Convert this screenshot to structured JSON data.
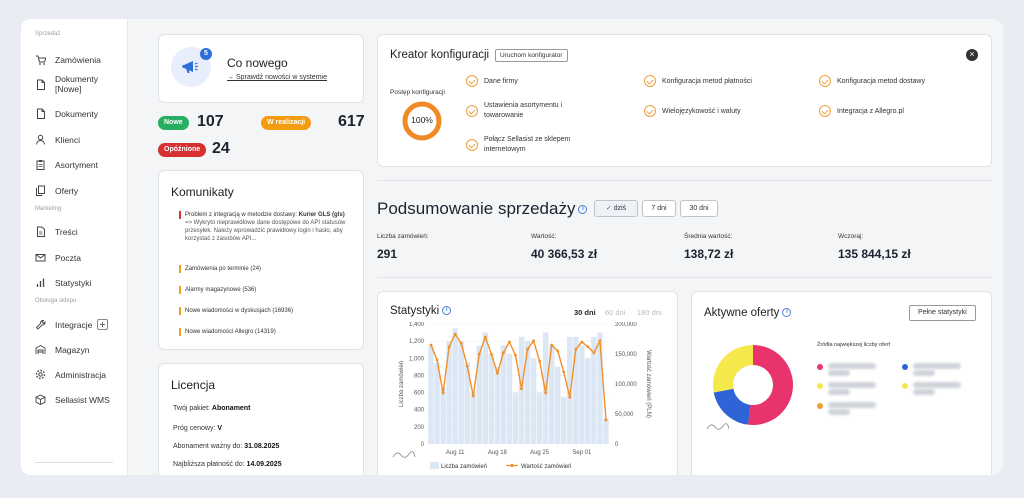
{
  "sidebar": {
    "sections": [
      {
        "title": "Sprzedaż",
        "items": [
          {
            "label": "Zamówienia",
            "icon": "cart-icon"
          },
          {
            "label": "Dokumenty\n[Nowe]",
            "icon": "document-icon"
          },
          {
            "label": "Dokumenty",
            "icon": "document-icon"
          },
          {
            "label": "Klienci",
            "icon": "user-icon"
          },
          {
            "label": "Asortyment",
            "icon": "clipboard-icon"
          },
          {
            "label": "Oferty",
            "icon": "copy-icon"
          }
        ]
      },
      {
        "title": "Marketing",
        "items": [
          {
            "label": "Treści",
            "icon": "file-text-icon"
          },
          {
            "label": "Poczta",
            "icon": "mail-icon"
          },
          {
            "label": "Statystyki",
            "icon": "bar-chart-icon"
          }
        ]
      },
      {
        "title": "Obsługa sklepu",
        "items": [
          {
            "label": "Integracje",
            "icon": "wrench-icon"
          },
          {
            "label": "Magazyn",
            "icon": "warehouse-icon"
          },
          {
            "label": "Administracja",
            "icon": "gear-icon"
          },
          {
            "label": "Sellasist WMS",
            "icon": "box-icon"
          }
        ]
      }
    ]
  },
  "news": {
    "title": "Co nowego",
    "link": "→ Sprawdź nowości w systemie",
    "badge": "5"
  },
  "order_status": [
    {
      "label": "Nowe",
      "count": "107",
      "color": "#27ae60"
    },
    {
      "label": "W realizacji",
      "count": "617",
      "color": "#f39c12"
    },
    {
      "label": "Opóźnione",
      "count": "24",
      "color": "#d63031"
    }
  ],
  "messages": {
    "title": "Komunikaty",
    "main": {
      "lead": "Problem z integracją w metodzie dostawy: ",
      "strong": "Kurier GLS (gls)",
      "detail": "=> Wykryto nieprawidłowe dane dostępowe do API statusów przesyłek. Należy wprowadzić prawidłowy login i hasło, aby korzystać z zasobów API..."
    },
    "items": [
      "Zamówienia po terminie (24)",
      "Alarmy magazynowe (536)",
      "Nowe wiadomości w dyskusjach (16936)",
      "Nowe wiadomości Allegro (14319)"
    ]
  },
  "license": {
    "title": "Licencja",
    "rows": [
      {
        "label": "Twój pakiet: ",
        "value": "Abonament"
      },
      {
        "label": "Próg cenowy: ",
        "value": "V"
      },
      {
        "label": "Abonament ważny do: ",
        "value": "31.08.2025"
      },
      {
        "label": "Najbliższa płatność do: ",
        "value": "14.09.2025"
      }
    ]
  },
  "wizard": {
    "title": "Kreator konfiguracji",
    "button": "Uruchom konfigurator",
    "progress_label": "Postęp konfiguracji",
    "progress_value": 1.0,
    "progress_text": "100%",
    "steps": [
      "Dane firmy",
      "Ustawienia asortymentu i towarowanie",
      "Połącz Sellasist ze sklepem internetowym",
      "Konfiguracja metod płatności",
      "Wielojęzykowość i waluty",
      "Konfiguracja metod dostawy",
      "Integracja z Allegro.pl"
    ]
  },
  "sales": {
    "title": "Podsumowanie sprzedaży",
    "filters": [
      "dziś",
      "7 dni",
      "30 dni"
    ],
    "stats": [
      {
        "label": "Liczba zamówień:",
        "value": "291"
      },
      {
        "label": "Wartość:",
        "value": "40 366,53 zł"
      },
      {
        "label": "Średnia wartość:",
        "value": "138,72 zł"
      },
      {
        "label": "Wczoraj:",
        "value": "135 844,15 zł"
      }
    ]
  },
  "stats_chart": {
    "title": "Statystyki",
    "ranges": [
      "30 dni",
      "60 dni",
      "180 dni"
    ],
    "left_axis_label": "Liczba zamówień",
    "right_axis_label": "Wartość zamówień (PLN)",
    "left_ticks": [
      "1,400",
      "1,200",
      "1,000",
      "800",
      "600",
      "400",
      "200",
      "0"
    ],
    "right_ticks": [
      "200,000",
      "150,000",
      "100,000",
      "50,000",
      "0"
    ],
    "x_ticks": [
      "Aug 11",
      "Aug 18",
      "Aug 25",
      "Sep 01"
    ],
    "legend": [
      "Liczba zamówień",
      "Wartość zamówień"
    ],
    "bar_color": "#dbe7f5",
    "line_color": "#f0902a"
  },
  "chart_data": {
    "type": "bar",
    "title": "Statystyki",
    "x": [
      "Aug 07",
      "Aug 08",
      "Aug 09",
      "Aug 10",
      "Aug 11",
      "Aug 12",
      "Aug 13",
      "Aug 14",
      "Aug 15",
      "Aug 16",
      "Aug 17",
      "Aug 18",
      "Aug 19",
      "Aug 20",
      "Aug 21",
      "Aug 22",
      "Aug 23",
      "Aug 24",
      "Aug 25",
      "Aug 26",
      "Aug 27",
      "Aug 28",
      "Aug 29",
      "Aug 30",
      "Aug 31",
      "Sep 01",
      "Sep 02",
      "Sep 03",
      "Sep 04",
      "Sep 05"
    ],
    "series": [
      {
        "name": "Liczba zamówień",
        "type": "bar",
        "axis": "left",
        "values": [
          1150,
          950,
          650,
          1200,
          1350,
          1200,
          950,
          600,
          1150,
          1300,
          1050,
          900,
          1150,
          1050,
          600,
          1250,
          1200,
          1000,
          600,
          1300,
          1150,
          900,
          550,
          1250,
          1250,
          1150,
          1000,
          1250,
          1300,
          300
        ]
      },
      {
        "name": "Wartość zamówień",
        "type": "line",
        "axis": "right",
        "values": [
          165000,
          140000,
          85000,
          162000,
          183000,
          168000,
          130000,
          80000,
          150000,
          178000,
          150000,
          118000,
          152000,
          170000,
          148000,
          92000,
          158000,
          172000,
          138000,
          85000,
          165000,
          155000,
          120000,
          78000,
          158000,
          170000,
          162000,
          152000,
          172000,
          40000
        ]
      }
    ],
    "ylim_left": [
      0,
      1400
    ],
    "ylim_right": [
      0,
      200000
    ]
  },
  "offers": {
    "title": "Aktywne oferty",
    "button": "Pełne statystyki",
    "subtitle": "Źródła największej liczby ofert",
    "donut": [
      {
        "value": 52,
        "color": "#e8336d"
      },
      {
        "value": 20,
        "color": "#2f64d8"
      },
      {
        "value": 28,
        "color": "#f5e84a"
      }
    ],
    "legend_colors": [
      "#e8336d",
      "#2f64d8",
      "#f5e84a",
      "#f5e84a",
      "#f0a030"
    ]
  }
}
